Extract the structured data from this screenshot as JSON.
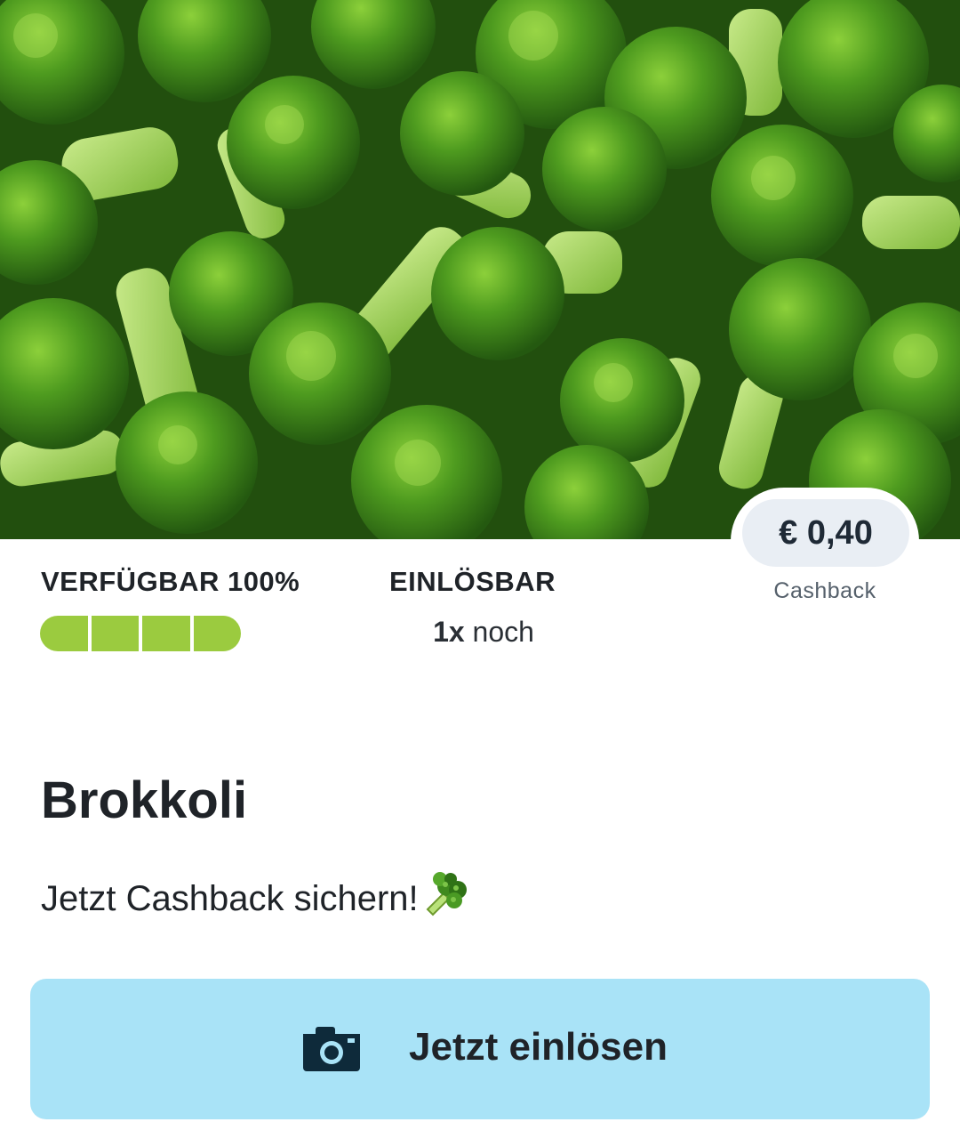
{
  "offer": {
    "cashback_amount": "€ 0,40",
    "cashback_label": "Cashback",
    "availability_label": "VERFÜGBAR 100%",
    "availability_fraction": 1.0,
    "redeemable_label": "EINLÖSBAR",
    "redeemable_count": "1x",
    "redeemable_suffix": "noch",
    "product_name": "Brokkoli",
    "tagline": "Jetzt Cashback sichern!",
    "tagline_icon": "broccoli-emoji",
    "button_label": "Jetzt einlösen",
    "button_icon": "camera-icon"
  },
  "colors": {
    "availability_bar": "#9bcb3f",
    "button_background": "#a9e3f7",
    "pill_background": "#e9eef4"
  }
}
